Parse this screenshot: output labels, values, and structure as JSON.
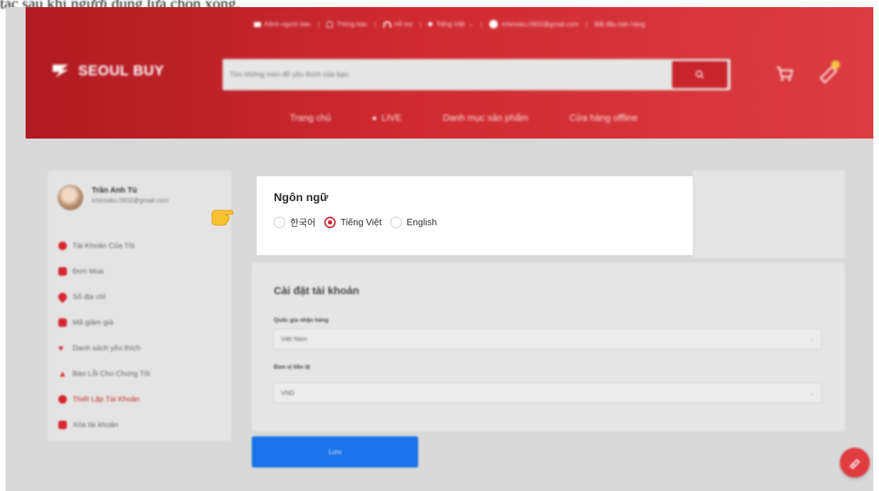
{
  "caption": "tác sau khi người dùng lựa chọn xong.",
  "topbar": {
    "seller_channel": "Kênh người bán",
    "notifications": "Thông báo",
    "support": "Hỗ trợ",
    "language": "Tiếng Việt",
    "email": "ichimoku.0902@gmail.com",
    "start_selling": "Bắt đầu bán hàng"
  },
  "logo": {
    "text": "SEOUL BUY"
  },
  "search": {
    "placeholder": "Tìm những món đồ yêu thích của bạn."
  },
  "nav": {
    "home": "Trang chủ",
    "live": "LIVE",
    "categories": "Danh mục sản phẩm",
    "offline_store": "Cửa hàng offline"
  },
  "profile": {
    "name": "Trần Anh Tú",
    "email": "ichimoku.0902@gmail.com"
  },
  "sidebar": {
    "items": [
      {
        "label": "Tài Khoản Của Tôi",
        "icon": "user-icon"
      },
      {
        "label": "Đơn Mua",
        "icon": "order-icon"
      },
      {
        "label": "Sổ địa chỉ",
        "icon": "location-icon"
      },
      {
        "label": "Mã giảm giá",
        "icon": "voucher-icon"
      },
      {
        "label": "Danh sách yêu thích",
        "icon": "heart-icon"
      },
      {
        "label": "Báo Lỗi Cho Chúng Tôi",
        "icon": "warning-icon"
      },
      {
        "label": "Thiết Lập Tài Khoản",
        "icon": "settings-icon",
        "active": true
      },
      {
        "label": "Xóa tài khoản",
        "icon": "trash-icon"
      }
    ]
  },
  "language_card": {
    "title": "Ngôn ngữ",
    "options": [
      "한국어",
      "Tiếng Việt",
      "English"
    ],
    "selected": "Tiếng Việt"
  },
  "account_settings": {
    "title": "Cài đặt tài khoản",
    "country_label": "Quốc gia nhận hàng",
    "country_value": "Việt Nam",
    "currency_label": "Đơn vị tiền tệ",
    "currency_value": "VND"
  },
  "save_label": "Lưu",
  "colors": {
    "brand_red": "#c9232b",
    "save_blue": "#1a73e8",
    "radio_red": "#c42530"
  }
}
